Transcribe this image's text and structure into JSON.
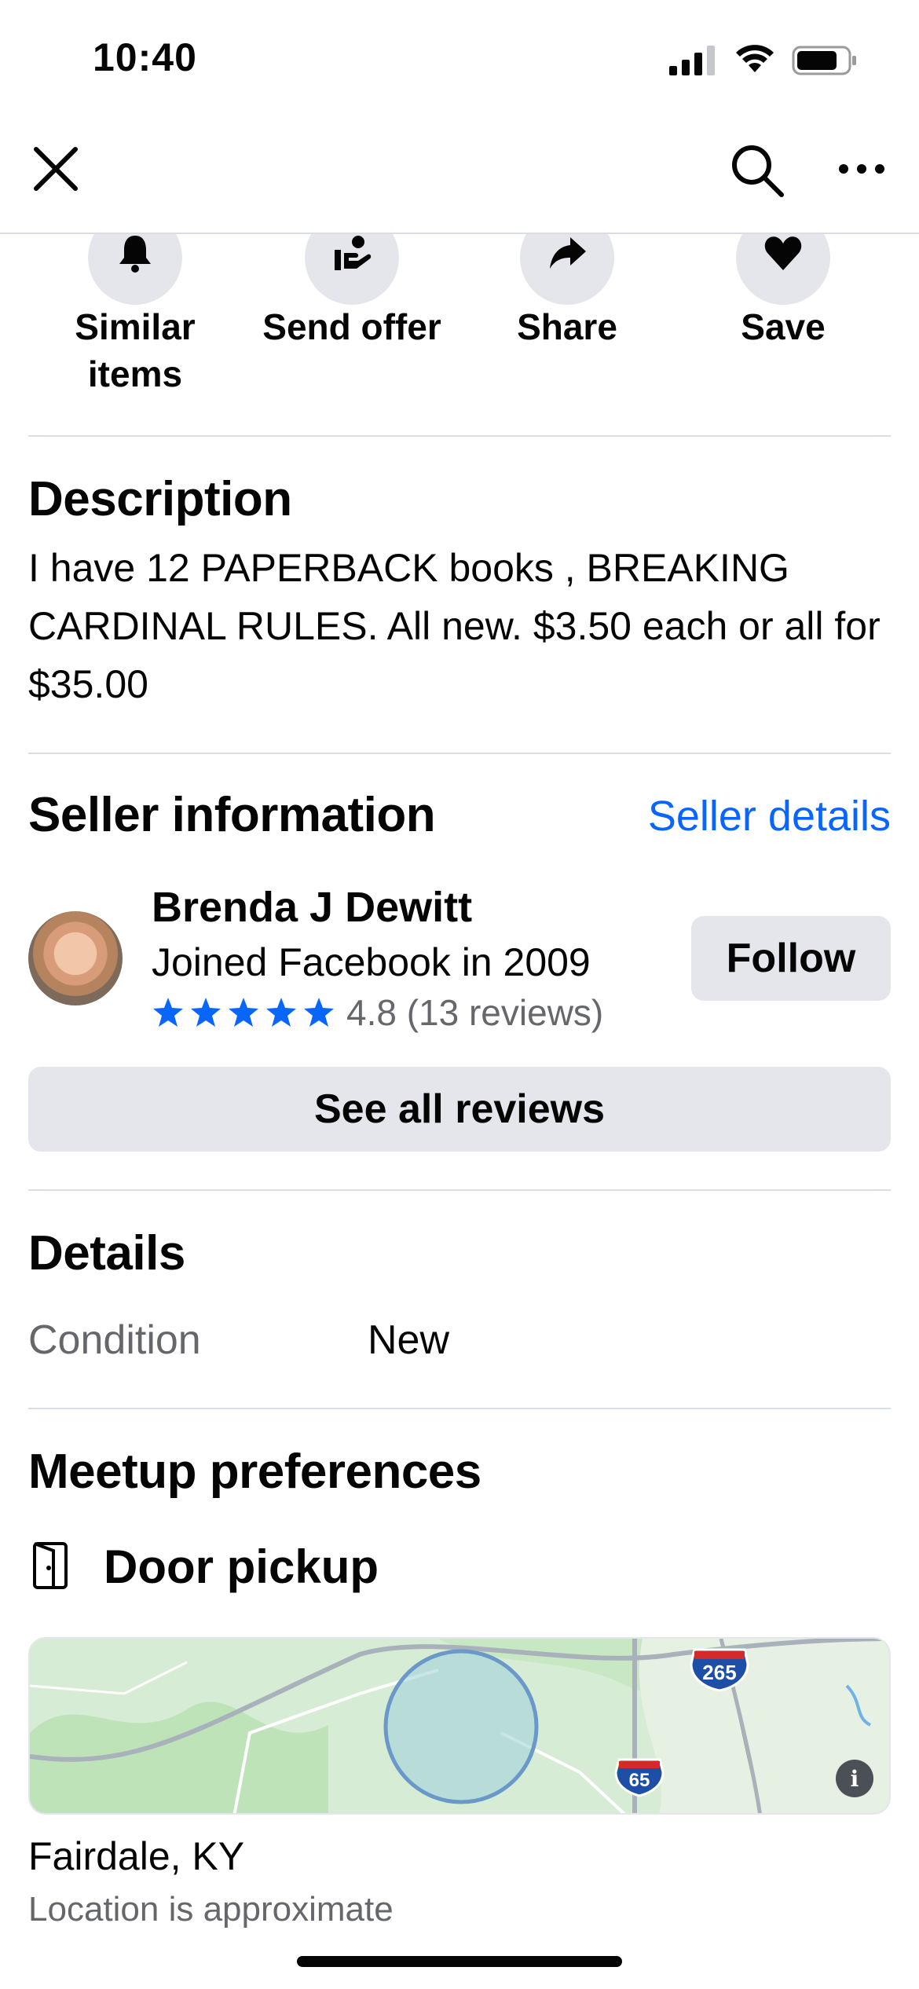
{
  "status_bar": {
    "time": "10:40"
  },
  "nav": {
    "close_icon": "close-icon",
    "search_icon": "search-icon",
    "more_icon": "more-icon"
  },
  "actions": [
    {
      "label": "Similar items",
      "icon": "bell-icon"
    },
    {
      "label": "Send offer",
      "icon": "offer-hand-icon"
    },
    {
      "label": "Share",
      "icon": "share-arrow-icon"
    },
    {
      "label": "Save",
      "icon": "heart-icon"
    }
  ],
  "description": {
    "title": "Description",
    "text": "I have 12 PAPERBACK books , BREAKING CARDINAL RULES. All new. $3.50 each or all for $35.00"
  },
  "seller": {
    "title": "Seller information",
    "details_link": "Seller details",
    "name": "Brenda J Dewitt",
    "joined": "Joined Facebook in 2009",
    "stars": 5,
    "rating_text": "4.8 (13 reviews)",
    "follow_label": "Follow",
    "see_reviews_label": "See all reviews"
  },
  "details": {
    "title": "Details",
    "condition_label": "Condition",
    "condition_value": "New"
  },
  "meetup": {
    "title": "Meetup preferences",
    "option": "Door pickup",
    "map_shields": [
      "265",
      "65"
    ],
    "location": "Fairdale, KY",
    "location_note": "Location is approximate"
  },
  "colors": {
    "accent": "#0866ff",
    "button_bg": "#e4e6eb",
    "secondary_text": "#65676b"
  }
}
